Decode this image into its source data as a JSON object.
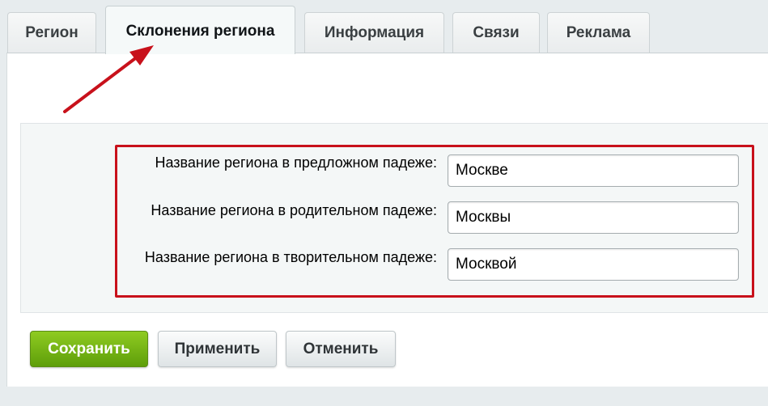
{
  "tabs": [
    {
      "label": "Регион",
      "active": false
    },
    {
      "label": "Склонения региона",
      "active": true
    },
    {
      "label": "Информация",
      "active": false
    },
    {
      "label": "Связи",
      "active": false
    },
    {
      "label": "Реклама",
      "active": false
    }
  ],
  "fields": [
    {
      "label": "Название региона в предложном падеже:",
      "value": "Москве"
    },
    {
      "label": "Название региона в родительном падеже:",
      "value": "Москвы"
    },
    {
      "label": "Название региона в творительном падеже:",
      "value": "Москвой"
    }
  ],
  "buttons": {
    "save": "Сохранить",
    "apply": "Применить",
    "cancel": "Отменить"
  },
  "colors": {
    "highlight": "#c8111b",
    "save_button": "#6fb314"
  }
}
